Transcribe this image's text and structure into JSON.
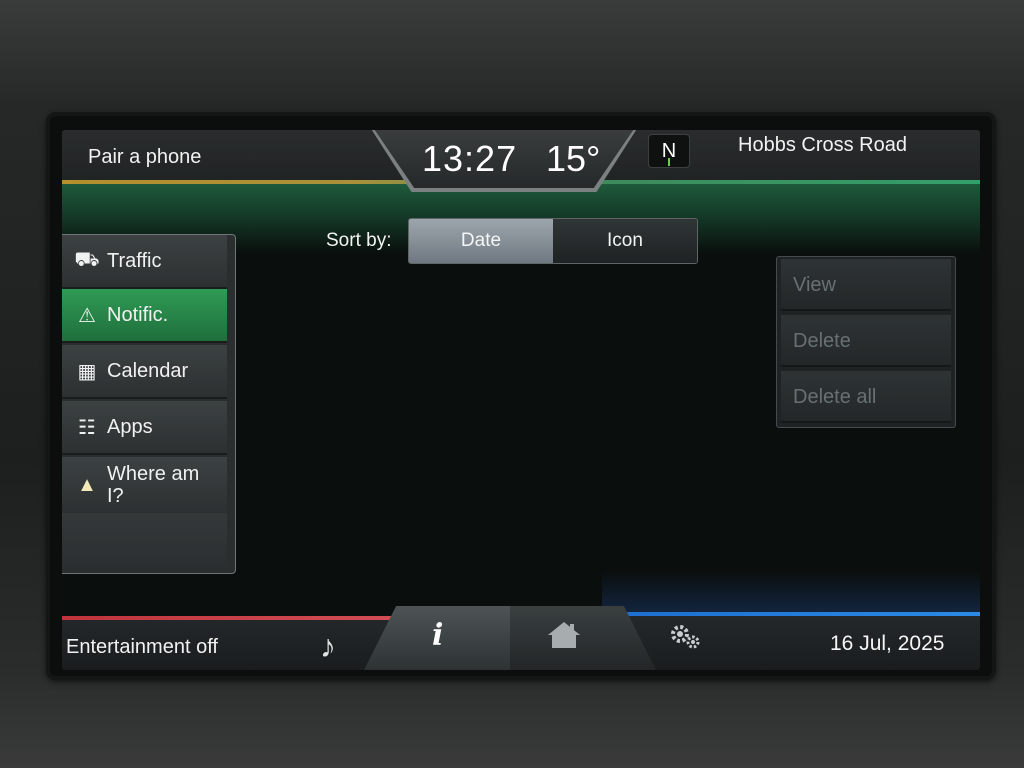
{
  "header": {
    "pair_phone": "Pair a phone",
    "time": "13:27",
    "temperature": "15°",
    "compass": "N",
    "location": "Hobbs Cross Road"
  },
  "sidebar": {
    "items": [
      {
        "label": "Traffic",
        "icon": "traffic-icon",
        "glyph": "⛟",
        "active": false
      },
      {
        "label": "Notific.",
        "icon": "warning-icon",
        "glyph": "⚠",
        "active": true
      },
      {
        "label": "Calendar",
        "icon": "calendar-icon",
        "glyph": "▦",
        "active": false
      },
      {
        "label": "Apps",
        "icon": "apps-list-icon",
        "glyph": "☷",
        "active": false
      },
      {
        "label": "Where am I?",
        "icon": "navigation-arrow-icon",
        "glyph": "▲",
        "active": false
      }
    ]
  },
  "sort": {
    "label": "Sort by:",
    "options": [
      "Date",
      "Icon"
    ],
    "selected": "Date"
  },
  "actions": {
    "view": "View",
    "delete": "Delete",
    "delete_all": "Delete all"
  },
  "footer": {
    "entertainment": "Entertainment off",
    "date": "16 Jul, 2025"
  },
  "colors": {
    "accent_green": "#2f9b54",
    "stripe_yellow": "#b5902c",
    "stripe_red": "#c0343c",
    "stripe_blue": "#1e6fd0"
  }
}
